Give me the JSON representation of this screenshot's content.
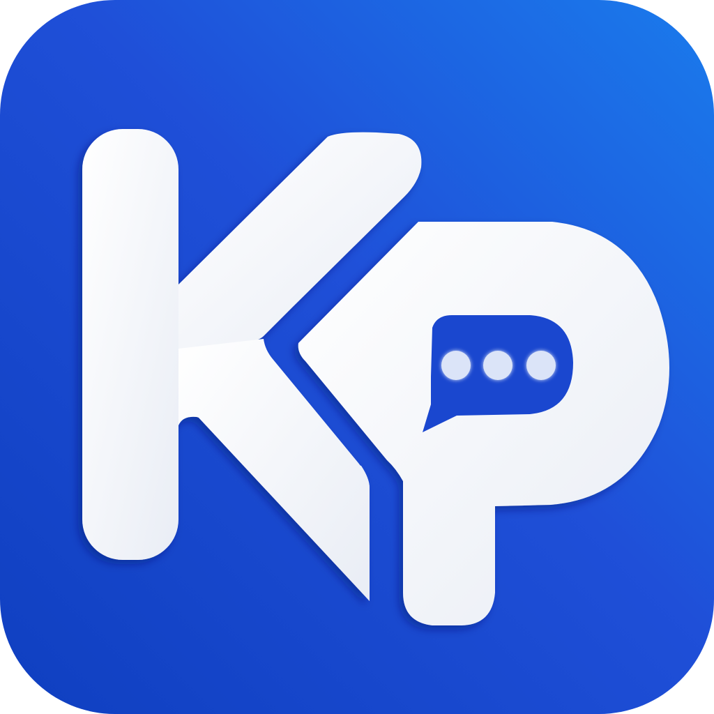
{
  "logo": {
    "letters": "KP",
    "icon_name": "chat-bubble-icon",
    "colors": {
      "background_start": "#1a44c8",
      "background_end": "#1b78ea",
      "letter": "#f4f6fb",
      "bubble": "#1a47cf",
      "dots": "#d7e1f8"
    },
    "bubble_dots": 3
  }
}
